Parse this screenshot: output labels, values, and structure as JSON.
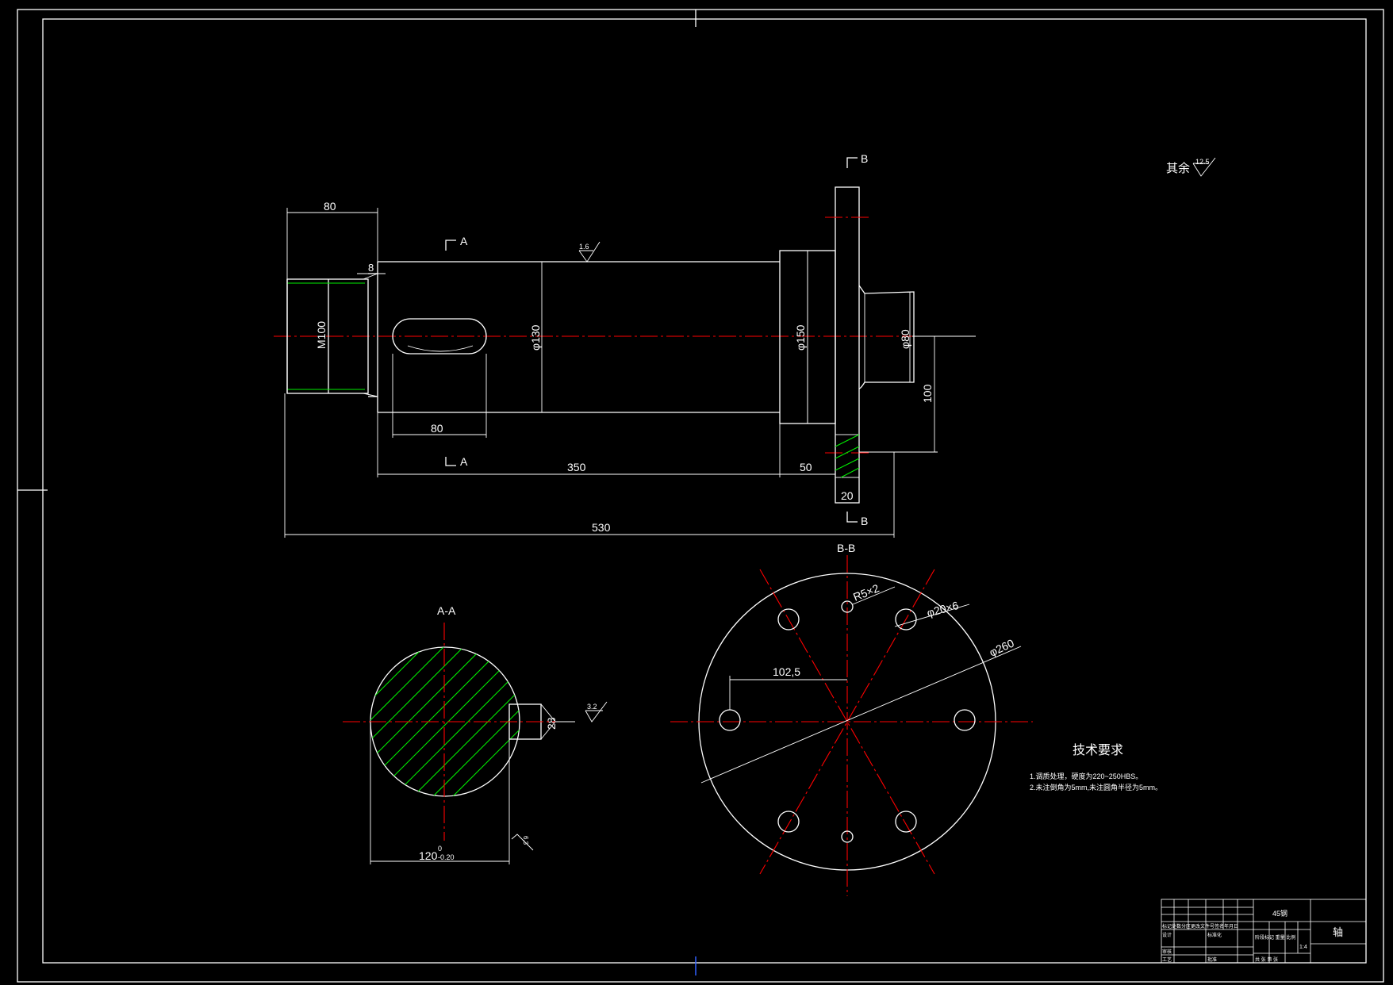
{
  "drawing": {
    "surface_note": "其余",
    "surface_note_value": "12.5",
    "front_view": {
      "section_a_top": "A",
      "section_a_bottom": "A",
      "section_b_top": "B",
      "section_b_bottom": "B",
      "roughness_top": "1.6",
      "dims": {
        "thread_length": "80",
        "chamfer": "8",
        "thread": "M100",
        "keyway_length": "80",
        "dia_main": "φ130",
        "dia_flange_hub": "φ150",
        "dia_end": "φ80",
        "offset_100": "100",
        "len_350": "350",
        "len_50": "50",
        "flange_thk": "20",
        "total_len": "530"
      }
    },
    "section_aa": {
      "title": "A-A",
      "key_width": "28",
      "roughness": "3.2",
      "roughness2": "6.3",
      "dim_main": "120",
      "tol_upper": "0",
      "tol_lower": "-0.20"
    },
    "section_bb": {
      "title": "B-B",
      "r_holes": "R5×2",
      "bolt_holes": "φ20×6",
      "dia_outer": "φ260",
      "pcd_radius": "102,5"
    },
    "tech_req": {
      "title": "技术要求",
      "item1": "1.调质处理，硬度为220~250HBS。",
      "item2": "2.未注倒角为5mm,未注圆角半径为5mm。"
    },
    "title_block": {
      "material": "45钢",
      "part_name": "轴",
      "scale": "1:4",
      "header_row": "标记处数分区更改文件号签名年月日",
      "designer": "设计",
      "standard": "标准化",
      "checker": "审核",
      "process": "工艺",
      "approve": "批准",
      "stage_labels": "阶段标记 重量 比例",
      "sheet": "共 张 第 张"
    }
  },
  "colors": {
    "background": "#000000",
    "lines": "#ffffff",
    "centerlines": "#ff0000",
    "hatch": "#00ee00"
  }
}
